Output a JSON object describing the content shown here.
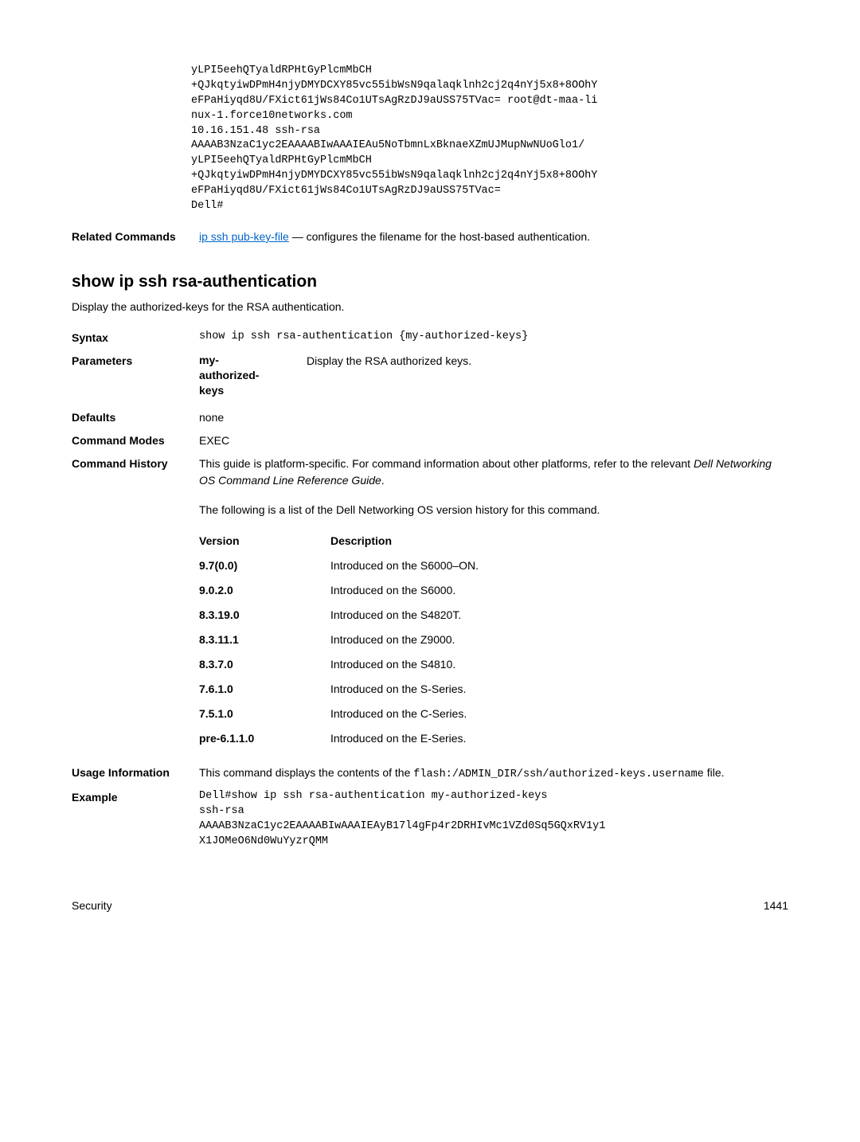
{
  "top_code": "yLPI5eehQTyaldRPHtGyPlcmMbCH\n+QJkqtyiwDPmH4njyDMYDCXY85vc55ibWsN9qalaqklnh2cj2q4nYj5x8+8OOhY\neFPaHiyqd8U/FXict61jWs84Co1UTsAgRzDJ9aUSS75TVac= root@dt-maa-li\nnux-1.force10networks.com\n10.16.151.48 ssh-rsa\nAAAAB3NzaC1yc2EAAAABIwAAAIEAu5NoTbmnLxBknaeXZmUJMupNwNUoGlo1/\nyLPI5eehQTyaldRPHtGyPlcmMbCH\n+QJkqtyiwDPmH4njyDMYDCXY85vc55ibWsN9qalaqklnh2cj2q4nYj5x8+8OOhY\neFPaHiyqd8U/FXict61jWs84Co1UTsAgRzDJ9aUSS75TVac=\nDell#",
  "related": {
    "label": "Related Commands",
    "link_text": "ip ssh pub-key-file",
    "rest": " — configures the filename for the host-based authentication."
  },
  "heading": "show ip ssh rsa-authentication",
  "intro": "Display the authorized-keys for the RSA authentication.",
  "syntax": {
    "label": "Syntax",
    "code": "show ip ssh rsa-authentication {my-authorized-keys}"
  },
  "parameters": {
    "label": "Parameters",
    "name": "my-\nauthorized-\nkeys",
    "desc": "Display the RSA authorized keys."
  },
  "defaults": {
    "label": "Defaults",
    "value": "none"
  },
  "modes": {
    "label": "Command Modes",
    "value": "EXEC"
  },
  "history": {
    "label": "Command History",
    "para1_a": "This guide is platform-specific. For command information about other platforms, refer to the relevant ",
    "para1_italic": "Dell Networking OS Command Line Reference Guide",
    "para1_b": ".",
    "para2": "The following is a list of the Dell Networking OS version history for this command.",
    "col1": "Version",
    "col2": "Description",
    "rows": [
      {
        "ver": "9.7(0.0)",
        "desc": "Introduced on the S6000–ON."
      },
      {
        "ver": "9.0.2.0",
        "desc": "Introduced on the S6000."
      },
      {
        "ver": "8.3.19.0",
        "desc": "Introduced on the S4820T."
      },
      {
        "ver": "8.3.11.1",
        "desc": "Introduced on the Z9000."
      },
      {
        "ver": "8.3.7.0",
        "desc": "Introduced on the S4810."
      },
      {
        "ver": "7.6.1.0",
        "desc": "Introduced on the S-Series."
      },
      {
        "ver": "7.5.1.0",
        "desc": "Introduced on the C-Series."
      },
      {
        "ver": "pre-6.1.1.0",
        "desc": "Introduced on the E-Series."
      }
    ]
  },
  "usage": {
    "label": "Usage Information",
    "text_a": "This command displays the contents of the ",
    "code_a": "flash:/ADMIN_DIR/ssh/authorized-keys.username",
    "text_b": " file."
  },
  "example": {
    "label": "Example",
    "code": "Dell#show ip ssh rsa-authentication my-authorized-keys\nssh-rsa\nAAAAB3NzaC1yc2EAAAABIwAAAIEAyB17l4gFp4r2DRHIvMc1VZd0Sq5GQxRV1y1\nX1JOMeO6Nd0WuYyzrQMM"
  },
  "footer": {
    "left": "Security",
    "right": "1441"
  }
}
